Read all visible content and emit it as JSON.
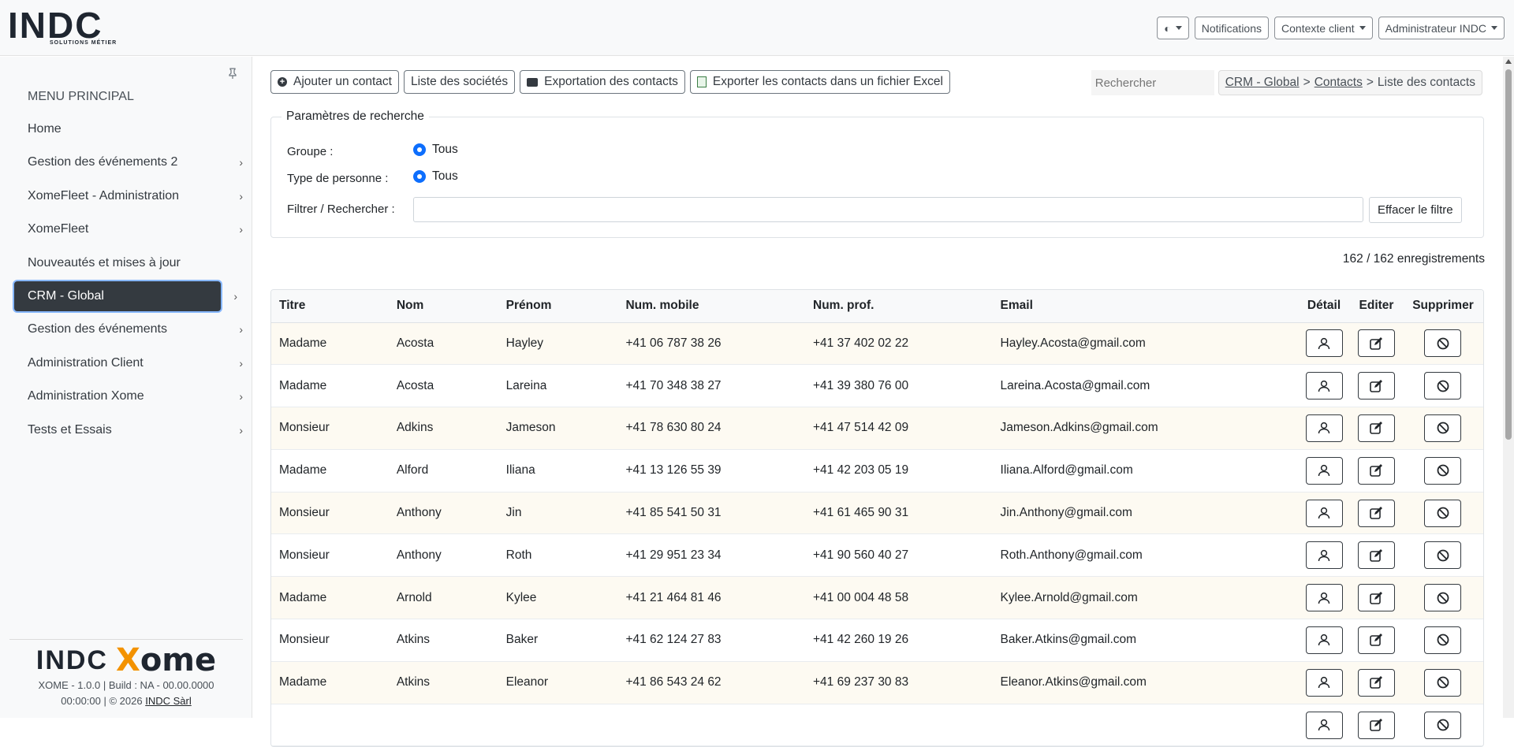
{
  "header": {
    "logo_text": "INDC",
    "logo_sub": "SOLUTIONS MÉTIER",
    "theme_label": "◐",
    "notifications": "Notifications",
    "client_context": "Contexte client",
    "user": "Administrateur INDC"
  },
  "sidebar": {
    "title": "MENU PRINCIPAL",
    "items": [
      {
        "label": "Home",
        "chevron": ""
      },
      {
        "label": "Gestion des événements 2",
        "chevron": "›"
      },
      {
        "label": "XomeFleet - Administration",
        "chevron": "›"
      },
      {
        "label": "XomeFleet",
        "chevron": "›"
      },
      {
        "label": "Nouveautés et mises à jour",
        "chevron": ""
      },
      {
        "label": "CRM - Global",
        "chevron": "›"
      },
      {
        "label": "Gestion des événements",
        "chevron": "›"
      },
      {
        "label": "Administration Client",
        "chevron": "›"
      },
      {
        "label": "Administration Xome",
        "chevron": "›"
      },
      {
        "label": "Tests et Essais",
        "chevron": "›"
      }
    ],
    "footer": {
      "logo_indc": "INDC",
      "logo_xome_x": "X",
      "logo_xome_rest": "ome",
      "version_line1": "XOME - 1.0.0 | Build : NA - 00.00.0000",
      "version_line2": "00:00:00 | © 2026",
      "company": "INDC Sàrl"
    }
  },
  "toolbar": {
    "add_contact": "Ajouter un contact",
    "company_list": "Liste des sociétés",
    "export_contacts": "Exportation des contacts",
    "export_excel": "Exporter les contacts dans un fichier Excel"
  },
  "search": {
    "placeholder": "Rechercher"
  },
  "breadcrumb": {
    "crm": "CRM - Global",
    "contacts": "Contacts",
    "current": "Liste des contacts",
    "sep": ">"
  },
  "filters": {
    "legend": "Paramètres de recherche",
    "group_label": "Groupe :",
    "group_value": "Tous",
    "type_label": "Type de personne :",
    "type_value": "Tous",
    "filter_label": "Filtrer / Rechercher :",
    "filter_value": "",
    "clear_button": "Effacer le filtre"
  },
  "records": "162 / 162 enregistrements",
  "table": {
    "headers": [
      "Titre",
      "Nom",
      "Prénom",
      "Num. mobile",
      "Num. prof.",
      "Email",
      "Détail",
      "Editer",
      "Supprimer"
    ],
    "rows": [
      [
        "Madame",
        "Acosta",
        "Hayley",
        "+41 06 787 38 26",
        "+41 37 402 02 22",
        "Hayley.Acosta@gmail.com"
      ],
      [
        "Madame",
        "Acosta",
        "Lareina",
        "+41 70 348 38 27",
        "+41 39 380 76 00",
        "Lareina.Acosta@gmail.com"
      ],
      [
        "Monsieur",
        "Adkins",
        "Jameson",
        "+41 78 630 80 24",
        "+41 47 514 42 09",
        "Jameson.Adkins@gmail.com"
      ],
      [
        "Madame",
        "Alford",
        "Iliana",
        "+41 13 126 55 39",
        "+41 42 203 05 19",
        "Iliana.Alford@gmail.com"
      ],
      [
        "Monsieur",
        "Anthony",
        "Jin",
        "+41 85 541 50 31",
        "+41 61 465 90 31",
        "Jin.Anthony@gmail.com"
      ],
      [
        "Monsieur",
        "Anthony",
        "Roth",
        "+41 29 951 23 34",
        "+41 90 560 40 27",
        "Roth.Anthony@gmail.com"
      ],
      [
        "Madame",
        "Arnold",
        "Kylee",
        "+41 21 464 81 46",
        "+41 00 004 48 58",
        "Kylee.Arnold@gmail.com"
      ],
      [
        "Monsieur",
        "Atkins",
        "Baker",
        "+41 62 124 27 83",
        "+41 42 260 19 26",
        "Baker.Atkins@gmail.com"
      ],
      [
        "Madame",
        "Atkins",
        "Eleanor",
        "+41 86 543 24 62",
        "+41 69 237 30 83",
        "Eleanor.Atkins@gmail.com"
      ],
      [
        "",
        "",
        "",
        "",
        "",
        ""
      ]
    ]
  },
  "icons": {
    "detail": "user-icon",
    "edit": "edit-icon",
    "delete": "ban-icon",
    "pin": "pin-icon"
  },
  "colors": {
    "accent": "#0d6efd",
    "active_menu": "#343a40",
    "brand_orange": "#f39200"
  }
}
